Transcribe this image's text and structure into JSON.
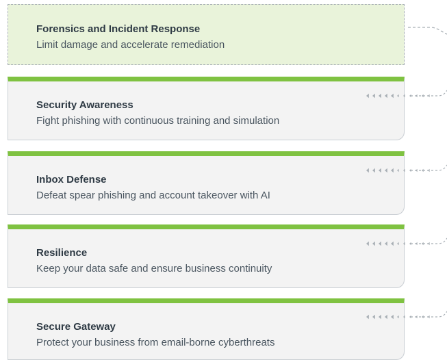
{
  "layers": [
    {
      "id": "forensics",
      "title": "Forensics and Incident Response",
      "description": "Limit damage and accelerate remediation",
      "style": "highlighted"
    },
    {
      "id": "security-awareness",
      "title": "Security Awareness",
      "description": "Fight phishing with continuous training and simulation",
      "style": "normal"
    },
    {
      "id": "inbox-defense",
      "title": "Inbox Defense",
      "description": "Defeat spear phishing and account takeover with AI",
      "style": "normal"
    },
    {
      "id": "resilience",
      "title": "Resilience",
      "description": "Keep your data safe and ensure business continuity",
      "style": "normal"
    },
    {
      "id": "secure-gateway",
      "title": "Secure Gateway",
      "description": "Protect your business from email-borne cyberthreats",
      "style": "normal"
    }
  ],
  "colors": {
    "accent": "#7fc241",
    "highlight_bg": "#e9f3da",
    "card_bg": "#f3f3f3",
    "connector": "#a8afb5",
    "title_text": "#2e3a44",
    "body_text": "#4a5660"
  }
}
